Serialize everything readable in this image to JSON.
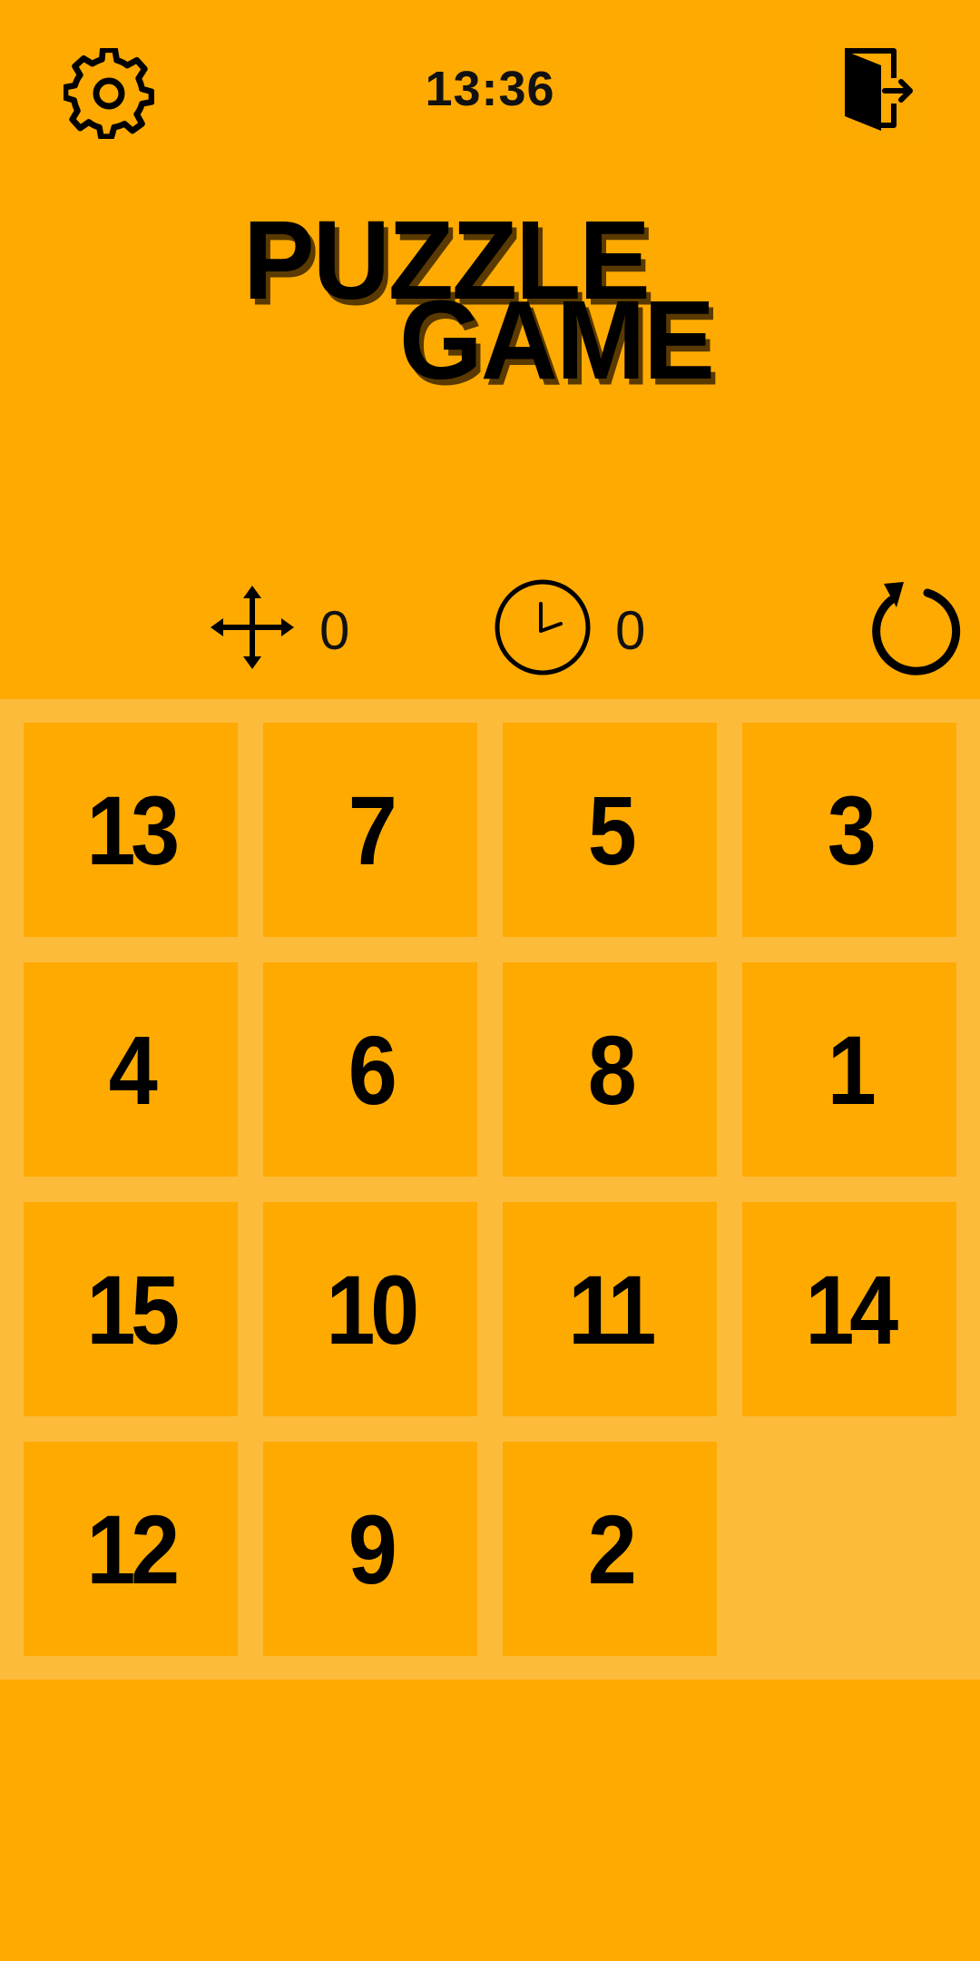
{
  "header": {
    "clock": "13:36",
    "settings_icon": "gear-icon",
    "exit_icon": "exit-door-icon"
  },
  "title": {
    "line1": "PUZZLE",
    "line2": "GAME"
  },
  "stats": {
    "moves": "0",
    "time": "0",
    "moves_icon": "move-arrows-icon",
    "timer_icon": "clock-icon",
    "restart_icon": "restart-icon"
  },
  "board": {
    "rows": [
      [
        "13",
        "7",
        "5",
        "3"
      ],
      [
        "4",
        "6",
        "8",
        "1"
      ],
      [
        "15",
        "10",
        "11",
        "14"
      ],
      [
        "12",
        "9",
        "2",
        ""
      ]
    ]
  },
  "colors": {
    "background": "#FFAA00",
    "board_background": "#FDBB3C",
    "tile": "#FFAA00",
    "text": "#000000"
  }
}
